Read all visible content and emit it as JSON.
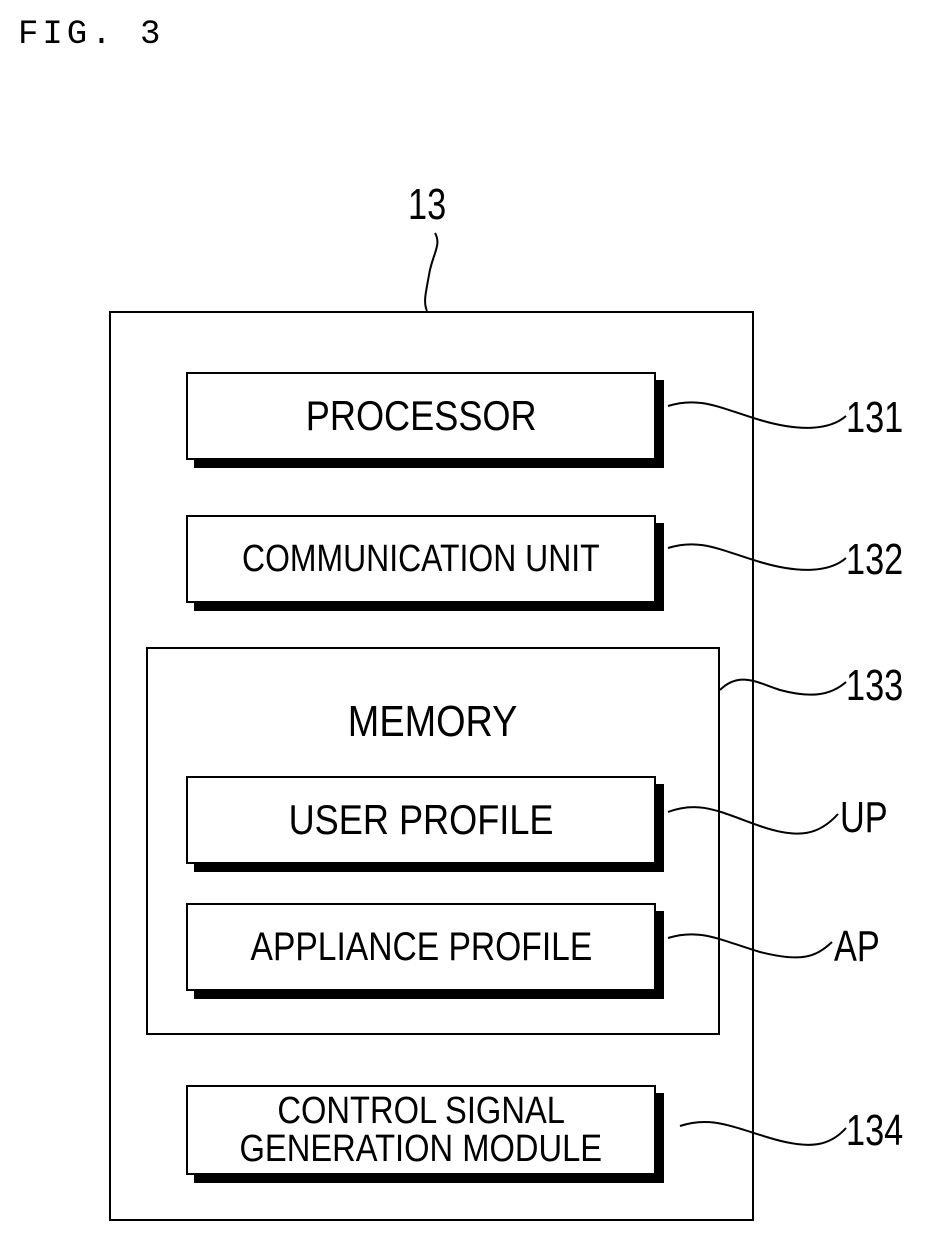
{
  "figure": {
    "label": "FIG. 3"
  },
  "device": {
    "ref": "13"
  },
  "components": {
    "processor": {
      "label": "PROCESSOR",
      "ref": "131"
    },
    "communication_unit": {
      "label": "COMMUNICATION UNIT",
      "ref": "132"
    },
    "memory": {
      "label": "MEMORY",
      "ref": "133",
      "user_profile": {
        "label": "USER PROFILE",
        "ref": "UP"
      },
      "appliance_profile": {
        "label": "APPLIANCE PROFILE",
        "ref": "AP"
      }
    },
    "control_signal_module": {
      "label_line1": "CONTROL SIGNAL",
      "label_line2": "GENERATION MODULE",
      "ref": "134"
    }
  }
}
